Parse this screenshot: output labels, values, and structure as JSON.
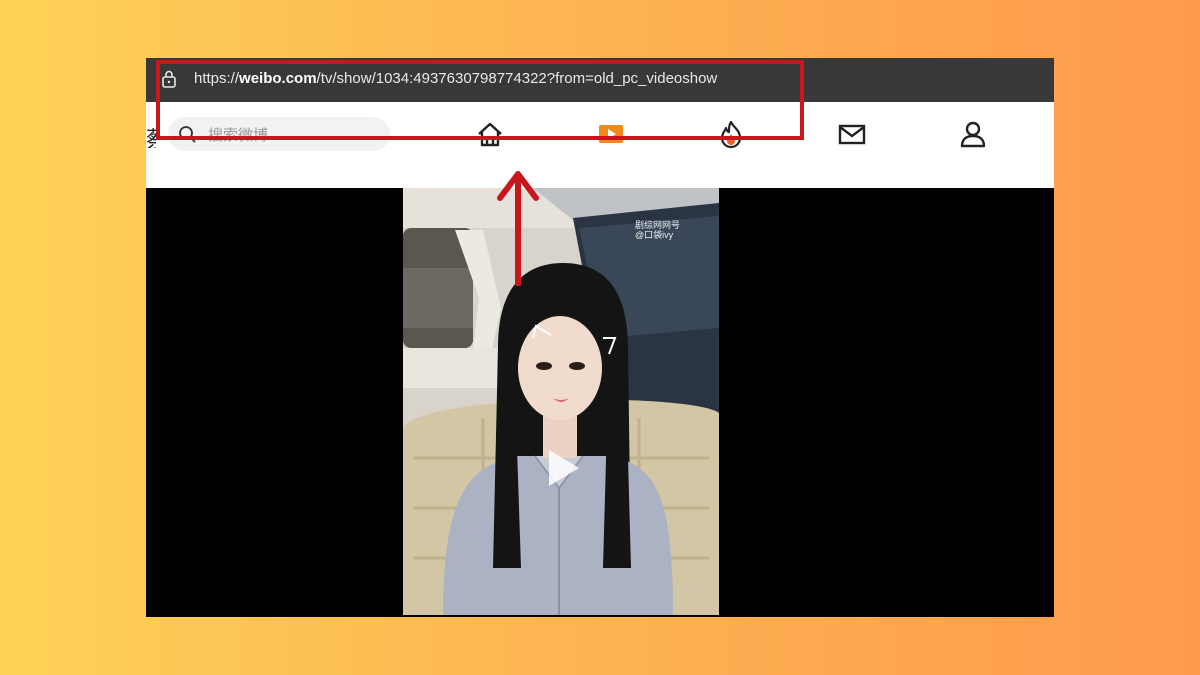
{
  "browser": {
    "url_prefix": "https://",
    "url_host": "weibo.com",
    "url_path": "/tv/show/1034:4937630798774322?from=old_pc_videoshow"
  },
  "nav": {
    "logo_fragment": "蔡",
    "search_placeholder": "搜索微博",
    "icons": [
      "home-icon",
      "video-icon",
      "hot-icon",
      "mail-icon",
      "profile-icon"
    ],
    "active_item": "video"
  },
  "video": {
    "watermark_line1": "剧综网网号",
    "watermark_line2": "@口袋ivy"
  },
  "colors": {
    "highlight": "#c9161c",
    "accent": "#f0a13a",
    "video_icon": "#f08a1c",
    "hot_icon": "#e8632b"
  }
}
